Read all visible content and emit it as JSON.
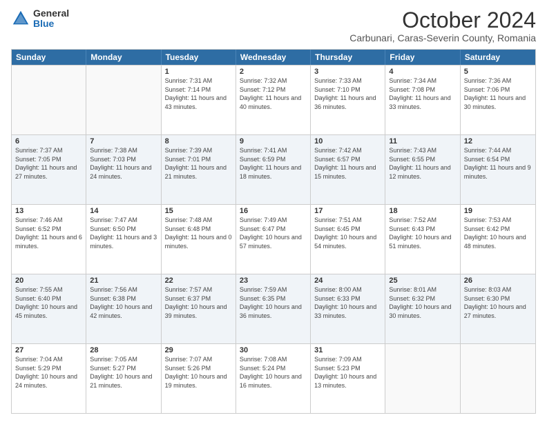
{
  "header": {
    "logo_general": "General",
    "logo_blue": "Blue",
    "month_title": "October 2024",
    "location": "Carbunari, Caras-Severin County, Romania"
  },
  "days_of_week": [
    "Sunday",
    "Monday",
    "Tuesday",
    "Wednesday",
    "Thursday",
    "Friday",
    "Saturday"
  ],
  "weeks": [
    [
      {
        "day": "",
        "info": ""
      },
      {
        "day": "",
        "info": ""
      },
      {
        "day": "1",
        "info": "Sunrise: 7:31 AM\nSunset: 7:14 PM\nDaylight: 11 hours and 43 minutes."
      },
      {
        "day": "2",
        "info": "Sunrise: 7:32 AM\nSunset: 7:12 PM\nDaylight: 11 hours and 40 minutes."
      },
      {
        "day": "3",
        "info": "Sunrise: 7:33 AM\nSunset: 7:10 PM\nDaylight: 11 hours and 36 minutes."
      },
      {
        "day": "4",
        "info": "Sunrise: 7:34 AM\nSunset: 7:08 PM\nDaylight: 11 hours and 33 minutes."
      },
      {
        "day": "5",
        "info": "Sunrise: 7:36 AM\nSunset: 7:06 PM\nDaylight: 11 hours and 30 minutes."
      }
    ],
    [
      {
        "day": "6",
        "info": "Sunrise: 7:37 AM\nSunset: 7:05 PM\nDaylight: 11 hours and 27 minutes."
      },
      {
        "day": "7",
        "info": "Sunrise: 7:38 AM\nSunset: 7:03 PM\nDaylight: 11 hours and 24 minutes."
      },
      {
        "day": "8",
        "info": "Sunrise: 7:39 AM\nSunset: 7:01 PM\nDaylight: 11 hours and 21 minutes."
      },
      {
        "day": "9",
        "info": "Sunrise: 7:41 AM\nSunset: 6:59 PM\nDaylight: 11 hours and 18 minutes."
      },
      {
        "day": "10",
        "info": "Sunrise: 7:42 AM\nSunset: 6:57 PM\nDaylight: 11 hours and 15 minutes."
      },
      {
        "day": "11",
        "info": "Sunrise: 7:43 AM\nSunset: 6:55 PM\nDaylight: 11 hours and 12 minutes."
      },
      {
        "day": "12",
        "info": "Sunrise: 7:44 AM\nSunset: 6:54 PM\nDaylight: 11 hours and 9 minutes."
      }
    ],
    [
      {
        "day": "13",
        "info": "Sunrise: 7:46 AM\nSunset: 6:52 PM\nDaylight: 11 hours and 6 minutes."
      },
      {
        "day": "14",
        "info": "Sunrise: 7:47 AM\nSunset: 6:50 PM\nDaylight: 11 hours and 3 minutes."
      },
      {
        "day": "15",
        "info": "Sunrise: 7:48 AM\nSunset: 6:48 PM\nDaylight: 11 hours and 0 minutes."
      },
      {
        "day": "16",
        "info": "Sunrise: 7:49 AM\nSunset: 6:47 PM\nDaylight: 10 hours and 57 minutes."
      },
      {
        "day": "17",
        "info": "Sunrise: 7:51 AM\nSunset: 6:45 PM\nDaylight: 10 hours and 54 minutes."
      },
      {
        "day": "18",
        "info": "Sunrise: 7:52 AM\nSunset: 6:43 PM\nDaylight: 10 hours and 51 minutes."
      },
      {
        "day": "19",
        "info": "Sunrise: 7:53 AM\nSunset: 6:42 PM\nDaylight: 10 hours and 48 minutes."
      }
    ],
    [
      {
        "day": "20",
        "info": "Sunrise: 7:55 AM\nSunset: 6:40 PM\nDaylight: 10 hours and 45 minutes."
      },
      {
        "day": "21",
        "info": "Sunrise: 7:56 AM\nSunset: 6:38 PM\nDaylight: 10 hours and 42 minutes."
      },
      {
        "day": "22",
        "info": "Sunrise: 7:57 AM\nSunset: 6:37 PM\nDaylight: 10 hours and 39 minutes."
      },
      {
        "day": "23",
        "info": "Sunrise: 7:59 AM\nSunset: 6:35 PM\nDaylight: 10 hours and 36 minutes."
      },
      {
        "day": "24",
        "info": "Sunrise: 8:00 AM\nSunset: 6:33 PM\nDaylight: 10 hours and 33 minutes."
      },
      {
        "day": "25",
        "info": "Sunrise: 8:01 AM\nSunset: 6:32 PM\nDaylight: 10 hours and 30 minutes."
      },
      {
        "day": "26",
        "info": "Sunrise: 8:03 AM\nSunset: 6:30 PM\nDaylight: 10 hours and 27 minutes."
      }
    ],
    [
      {
        "day": "27",
        "info": "Sunrise: 7:04 AM\nSunset: 5:29 PM\nDaylight: 10 hours and 24 minutes."
      },
      {
        "day": "28",
        "info": "Sunrise: 7:05 AM\nSunset: 5:27 PM\nDaylight: 10 hours and 21 minutes."
      },
      {
        "day": "29",
        "info": "Sunrise: 7:07 AM\nSunset: 5:26 PM\nDaylight: 10 hours and 19 minutes."
      },
      {
        "day": "30",
        "info": "Sunrise: 7:08 AM\nSunset: 5:24 PM\nDaylight: 10 hours and 16 minutes."
      },
      {
        "day": "31",
        "info": "Sunrise: 7:09 AM\nSunset: 5:23 PM\nDaylight: 10 hours and 13 minutes."
      },
      {
        "day": "",
        "info": ""
      },
      {
        "day": "",
        "info": ""
      }
    ]
  ]
}
